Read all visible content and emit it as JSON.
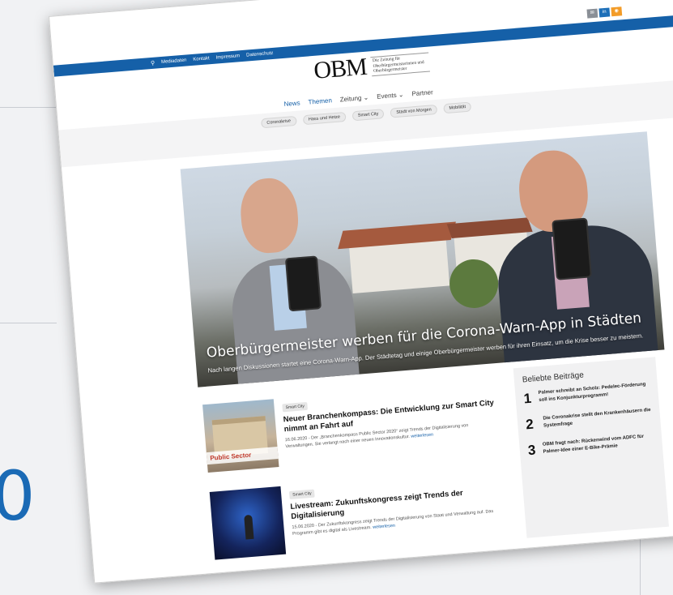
{
  "background": {
    "partial_number": "0"
  },
  "topbar": {
    "items": [
      "Mediadaten",
      "Kontakt",
      "Impressum",
      "Datenschutz"
    ]
  },
  "social": [
    {
      "icon": "mail-icon",
      "label": "✉",
      "color": "#8a8f96"
    },
    {
      "icon": "linkedin-icon",
      "label": "in",
      "color": "#1d6fb8"
    },
    {
      "icon": "rss-icon",
      "label": "◉",
      "color": "#f39c28"
    }
  ],
  "logo": {
    "text": "OBM",
    "tagline": "Die Zeitung für Oberbürgermeisterinnen und Oberbürgermeister"
  },
  "nav": {
    "items": [
      "News",
      "Themen",
      "Zeitung ⌄",
      "Events ⌄",
      "Partner"
    ]
  },
  "tags": [
    "Coronakrise",
    "Hass und Hetze",
    "Smart City",
    "Stadt von Morgen",
    "Mobilität"
  ],
  "hero": {
    "headline": "Oberbürgermeister werben für die Corona-Warn-App in Städten",
    "teaser": "Nach langen Diskussionen startet eine Corona-Warn-App. Der Städtetag und einige Oberbürgermeister werben für ihren Einsatz, um die Krise besser zu meistern."
  },
  "articles": [
    {
      "badge": "Smart City",
      "title": "Neuer Branchenkompass: Die Entwicklung zur Smart City nimmt an Fahrt auf",
      "text": "16.06.2020 - Der „Branchenkompass Public Sector 2020“ zeigt Trends der Digitalisierung von Verwaltungen. Sie verlangt nach einer neuen Innovationskultur.",
      "more": "weiterlesen",
      "thumb_text": "Public Sector"
    },
    {
      "badge": "Smart City",
      "title": "Livestream: Zukunftskongress zeigt Trends der Digitalisierung",
      "text": "15.06.2020 - Der Zukunftskongress zeigt Trends der Digitalisierung von Staat und Verwaltung auf. Das Programm gibt es digital als Livestream.",
      "more": "weiterlesen"
    }
  ],
  "sidebar": {
    "title": "Beliebte Beiträge",
    "items": [
      {
        "num": "1",
        "text": "Palmer schreibt an Scholz: Pedelec-Förderung soll ins Konjunkturprogramm!"
      },
      {
        "num": "2",
        "text": "Die Coronakrise stellt den Krankenhäusern die Systemfrage"
      },
      {
        "num": "3",
        "text": "OBM fragt nach: Rückenwind vom ADFC für Palmer-Idee einer E-Bike-Prämie"
      }
    ]
  }
}
